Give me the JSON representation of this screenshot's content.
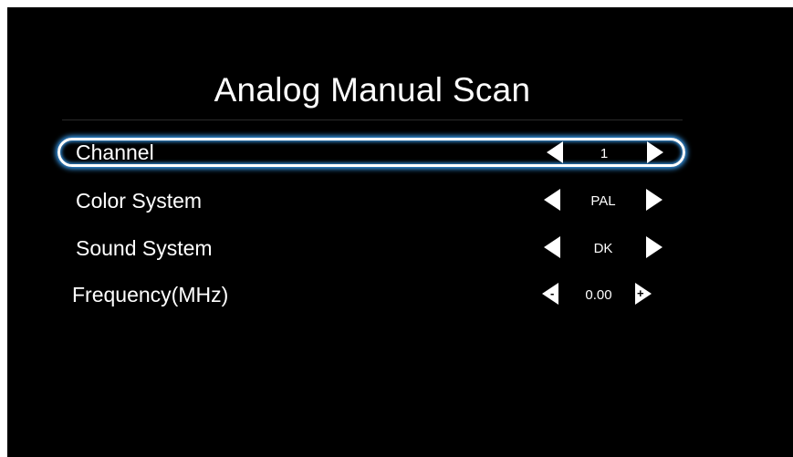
{
  "title": "Analog Manual Scan",
  "rows": [
    {
      "label": "Channel",
      "value": "1",
      "selected": true
    },
    {
      "label": "Color System",
      "value": "PAL",
      "selected": false
    },
    {
      "label": "Sound System",
      "value": "DK",
      "selected": false
    },
    {
      "label": "Frequency(MHz)",
      "value": "0.00",
      "selected": false,
      "decrement_glyph": "-",
      "increment_glyph": "+"
    }
  ],
  "colors": {
    "background": "#000000",
    "text": "#ffffff",
    "highlight_glow": "#3aa6ff"
  },
  "icons": {
    "left": "triangle-left-icon",
    "right": "triangle-right-icon"
  }
}
